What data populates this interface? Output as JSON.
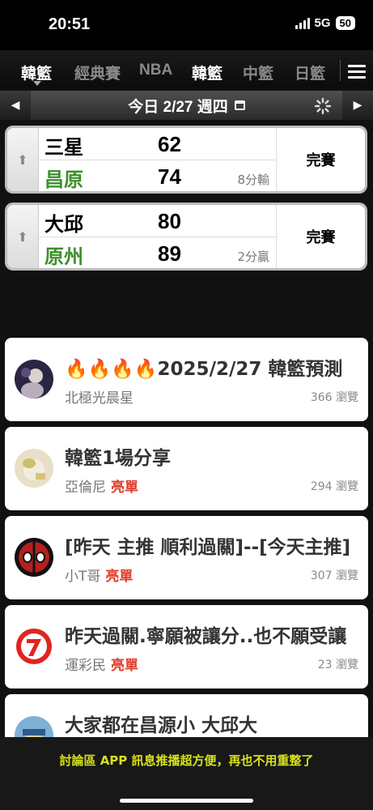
{
  "status_bar": {
    "time": "20:51",
    "network": "5G",
    "battery": "50"
  },
  "nav": {
    "league_selector": "韓籃",
    "tabs": [
      "經典賽",
      "NBA",
      "韓籃",
      "中籃",
      "日籃"
    ],
    "active_tab": "韓籃",
    "menu_icon": "hamburger-icon"
  },
  "date_bar": {
    "label": "今日 2/27 週四",
    "prev_icon": "triangle-left-icon",
    "next_icon": "triangle-right-icon",
    "calendar_icon": "calendar-icon",
    "loading_icon": "spinner-icon"
  },
  "games": [
    {
      "away": {
        "team": "三星",
        "score": "62"
      },
      "home": {
        "team": "昌原",
        "score": "74"
      },
      "result": "8分輸",
      "status": "完賽"
    },
    {
      "away": {
        "team": "大邱",
        "score": "80"
      },
      "home": {
        "team": "原州",
        "score": "89"
      },
      "result": "2分贏",
      "status": "完賽"
    }
  ],
  "posts": [
    {
      "title": "🔥🔥🔥🔥2025/2/27 韓籃預測",
      "author": "北極光晨星",
      "tag": "",
      "views": "366 瀏覽"
    },
    {
      "title": "韓籃1場分享",
      "author": "亞倫尼",
      "tag": "亮單",
      "views": "294 瀏覽"
    },
    {
      "title": "[昨天 主推 順利過關]--[今天主推]",
      "author": "小T哥",
      "tag": "亮單",
      "views": "307 瀏覽"
    },
    {
      "title": "昨天過關.寧願被讓分..也不願受讓",
      "author": "運彩民",
      "tag": "亮單",
      "views": "23 瀏覽"
    },
    {
      "title": "大家都在昌源小 大邱大",
      "author": "",
      "tag": "",
      "views": ""
    }
  ],
  "bottom_banner": {
    "text": "討論區 APP 訊息推播超方便，再也不用重整了"
  },
  "colors": {
    "home_team": "#3d8f2b",
    "tag": "#e23b2a",
    "banner_text": "#d7e21c"
  }
}
